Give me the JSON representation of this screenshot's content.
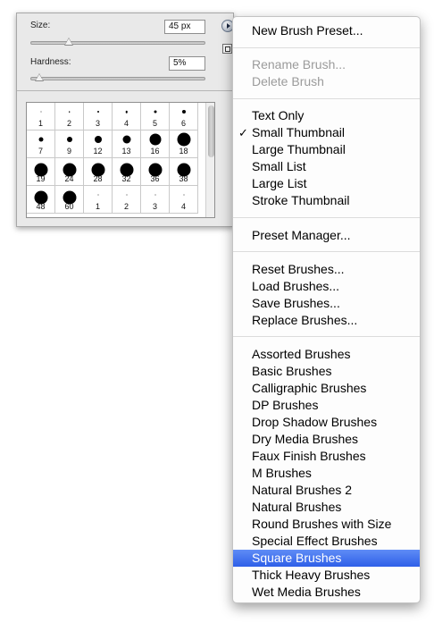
{
  "brush_panel": {
    "size_label": "Size:",
    "size_value": "45 px",
    "hardness_label": "Hardness:",
    "hardness_value": "5%",
    "brushes": [
      {
        "label": "1"
      },
      {
        "label": "2"
      },
      {
        "label": "3"
      },
      {
        "label": "4"
      },
      {
        "label": "5"
      },
      {
        "label": "6"
      },
      {
        "label": "7"
      },
      {
        "label": "9"
      },
      {
        "label": "12"
      },
      {
        "label": "13"
      },
      {
        "label": "16"
      },
      {
        "label": "18"
      },
      {
        "label": "19"
      },
      {
        "label": "24"
      },
      {
        "label": "28"
      },
      {
        "label": "32"
      },
      {
        "label": "36"
      },
      {
        "label": "38"
      },
      {
        "label": "48"
      },
      {
        "label": "60"
      },
      {
        "label": "1"
      },
      {
        "label": "2"
      },
      {
        "label": "3"
      },
      {
        "label": "4"
      }
    ]
  },
  "menu": {
    "items": [
      {
        "label": "New Brush Preset..."
      },
      {
        "label": "Rename Brush...",
        "disabled": true
      },
      {
        "label": "Delete Brush",
        "disabled": true
      },
      {
        "label": "Text Only"
      },
      {
        "label": "Small Thumbnail",
        "checked": true
      },
      {
        "label": "Large Thumbnail"
      },
      {
        "label": "Small List"
      },
      {
        "label": "Large List"
      },
      {
        "label": "Stroke Thumbnail"
      },
      {
        "label": "Preset Manager..."
      },
      {
        "label": "Reset Brushes..."
      },
      {
        "label": "Load Brushes..."
      },
      {
        "label": "Save Brushes..."
      },
      {
        "label": "Replace Brushes..."
      },
      {
        "label": "Assorted Brushes"
      },
      {
        "label": "Basic Brushes"
      },
      {
        "label": "Calligraphic Brushes"
      },
      {
        "label": "DP Brushes"
      },
      {
        "label": "Drop Shadow Brushes"
      },
      {
        "label": "Dry Media Brushes"
      },
      {
        "label": "Faux Finish Brushes"
      },
      {
        "label": "M Brushes"
      },
      {
        "label": "Natural Brushes 2"
      },
      {
        "label": "Natural Brushes"
      },
      {
        "label": "Round Brushes with Size"
      },
      {
        "label": "Special Effect Brushes"
      },
      {
        "label": "Square Brushes",
        "highlighted": true
      },
      {
        "label": "Thick Heavy Brushes"
      },
      {
        "label": "Wet Media Brushes"
      }
    ],
    "check_glyph": "✓",
    "highlight_color": "#3a6ded"
  }
}
